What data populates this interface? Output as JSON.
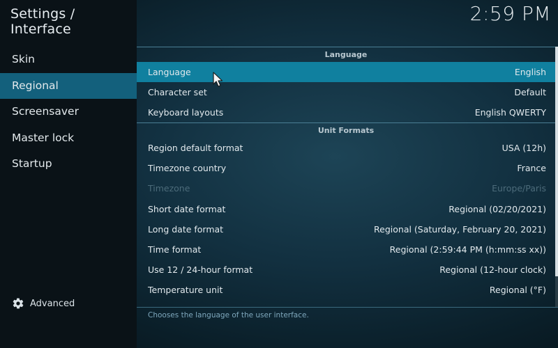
{
  "header": {
    "title": "Settings / Interface",
    "clock": "2:59 PM"
  },
  "sidebar": {
    "items": [
      {
        "label": "Skin"
      },
      {
        "label": "Regional"
      },
      {
        "label": "Screensaver"
      },
      {
        "label": "Master lock"
      },
      {
        "label": "Startup"
      }
    ],
    "active_index": 1,
    "advanced_label": "Advanced"
  },
  "sections": [
    {
      "title": "Language",
      "rows": [
        {
          "label": "Language",
          "value": "English"
        },
        {
          "label": "Character set",
          "value": "Default"
        },
        {
          "label": "Keyboard layouts",
          "value": "English QWERTY"
        }
      ]
    },
    {
      "title": "Unit Formats",
      "rows": [
        {
          "label": "Region default format",
          "value": "USA (12h)"
        },
        {
          "label": "Timezone country",
          "value": "France"
        },
        {
          "label": "Timezone",
          "value": "Europe/Paris"
        },
        {
          "label": "Short date format",
          "value": "Regional (02/20/2021)"
        },
        {
          "label": "Long date format",
          "value": "Regional (Saturday, February 20, 2021)"
        },
        {
          "label": "Time format",
          "value": "Regional (2:59:44 PM (h:mm:ss xx))"
        },
        {
          "label": "Use 12 / 24-hour format",
          "value": "Regional (12-hour clock)"
        },
        {
          "label": "Temperature unit",
          "value": "Regional (°F)"
        }
      ]
    }
  ],
  "footer": {
    "description": "Chooses the language of the user interface."
  },
  "colors": {
    "accent": "#10809f",
    "sidebar_active": "#13607c",
    "sidebar_bg": "#0a1217",
    "disabled_text": "#4c6b7a"
  },
  "icons": {
    "advanced": "gear-icon",
    "pointer": "mouse-cursor-icon"
  }
}
